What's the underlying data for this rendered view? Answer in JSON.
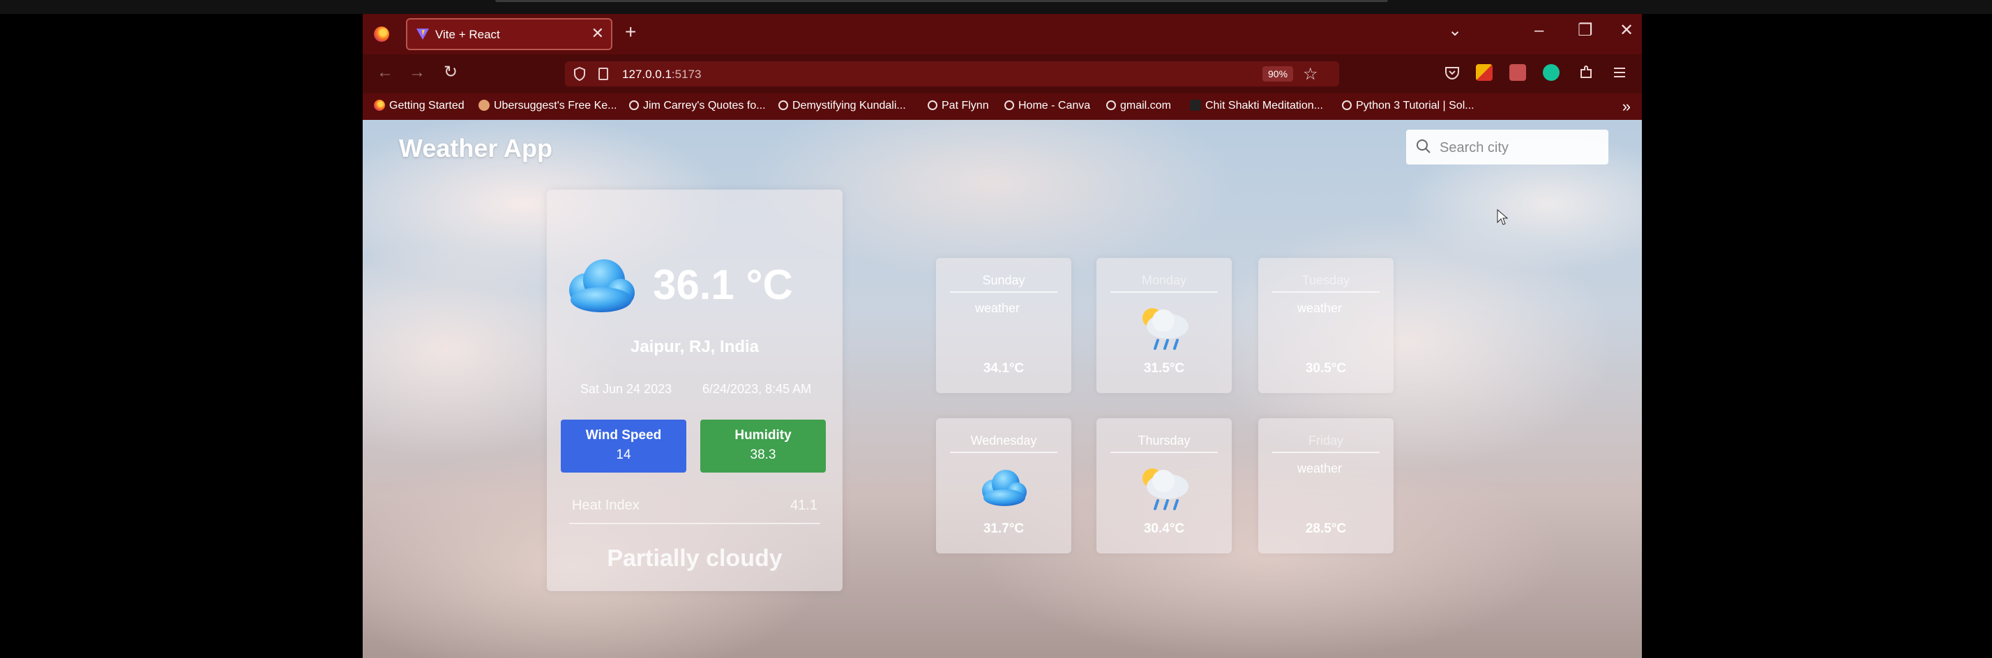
{
  "browser": {
    "tab_title": "Vite + React",
    "url_host": "127.0.0.1",
    "url_port": ":5173",
    "zoom": "90%",
    "bookmarks": [
      "Getting Started",
      "Ubersuggest's Free Ke...",
      "Jim Carrey's Quotes fo...",
      "Demystifying Kundali...",
      "Pat Flynn",
      "Home - Canva",
      "gmail.com",
      "Chit Shakti Meditation...",
      "Python 3 Tutorial | Sol..."
    ]
  },
  "app": {
    "title": "Weather App",
    "search_placeholder": "Search city"
  },
  "current": {
    "temperature": "36.1 °C",
    "location": "Jaipur, RJ, India",
    "date": "Sat Jun 24 2023",
    "datetime": "6/24/2023, 8:45 AM",
    "wind_label": "Wind Speed",
    "wind_value": "14",
    "humidity_label": "Humidity",
    "humidity_value": "38.3",
    "heat_index_label": "Heat Index",
    "heat_index_value": "41.1",
    "condition": "Partially cloudy"
  },
  "forecast": [
    {
      "day": "Sunday",
      "label": "weather",
      "temp": "34.1°C",
      "icon": "text"
    },
    {
      "day": "Monday",
      "label": "",
      "temp": "31.5°C",
      "icon": "sun-rain-icon"
    },
    {
      "day": "Tuesday",
      "label": "weather",
      "temp": "30.5°C",
      "icon": "text"
    },
    {
      "day": "Wednesday",
      "label": "",
      "temp": "31.7°C",
      "icon": "cloud-icon"
    },
    {
      "day": "Thursday",
      "label": "",
      "temp": "30.4°C",
      "icon": "sun-rain-icon"
    },
    {
      "day": "Friday",
      "label": "weather",
      "temp": "28.5°C",
      "icon": "text"
    }
  ],
  "colors": {
    "wind_card": "#3a67e4",
    "humidity_card": "#3fa04e",
    "browser_chrome": "#5a0b0b"
  }
}
